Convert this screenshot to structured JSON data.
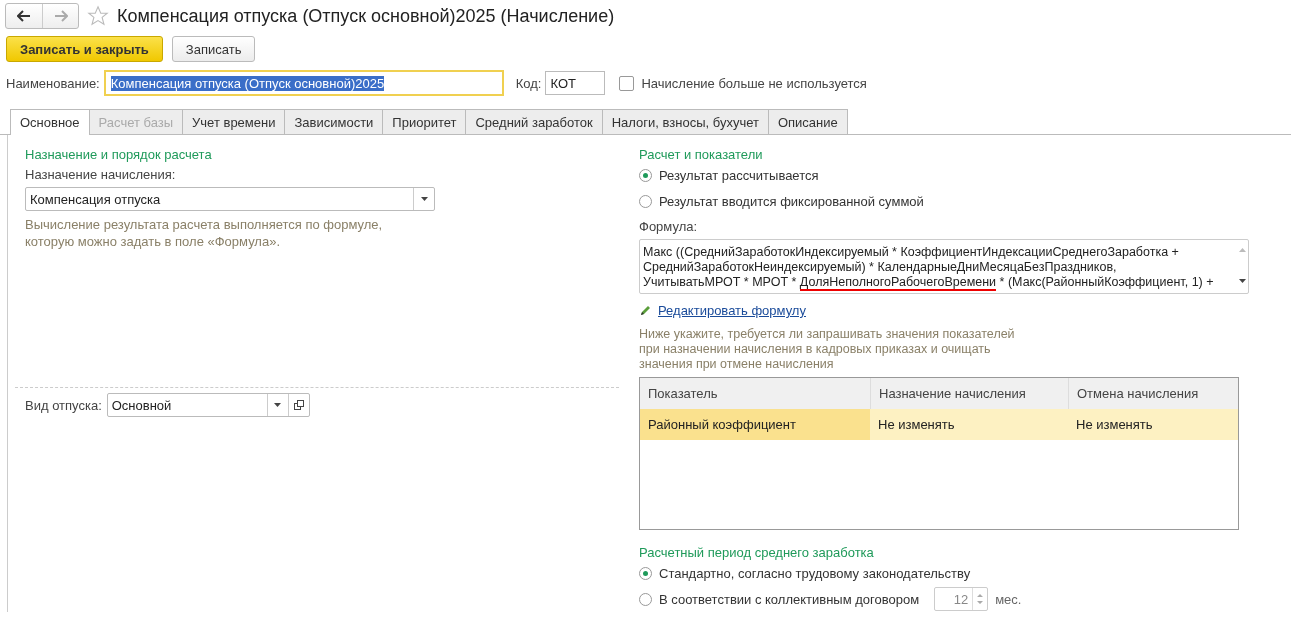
{
  "window": {
    "title": "Компенсация отпуска (Отпуск основной)2025 (Начисление)",
    "favorite": false
  },
  "toolbar": {
    "buttons": [
      {
        "label": "Записать и закрыть",
        "kind": "primary"
      },
      {
        "label": "Записать",
        "kind": "normal"
      }
    ]
  },
  "name_row": {
    "name_label": "Наименование:",
    "name_value": "Компенсация отпуска (Отпуск основной)2025",
    "code_label": "Код:",
    "code_value": "КОТ",
    "unused_label": "Начисление больше не используется",
    "unused_checked": false
  },
  "tabs": [
    {
      "label": "Основное",
      "selected": true,
      "disabled": false
    },
    {
      "label": "Расчет базы",
      "selected": false,
      "disabled": true
    },
    {
      "label": "Учет времени",
      "selected": false,
      "disabled": false
    },
    {
      "label": "Зависимости",
      "selected": false,
      "disabled": false
    },
    {
      "label": "Приоритет",
      "selected": false,
      "disabled": false
    },
    {
      "label": "Средний заработок",
      "selected": false,
      "disabled": false
    },
    {
      "label": "Налоги, взносы, бухучет",
      "selected": false,
      "disabled": false
    },
    {
      "label": "Описание",
      "selected": false,
      "disabled": false
    }
  ],
  "purpose": {
    "title": "Назначение и порядок расчета",
    "label": "Назначение начисления:",
    "value": "Компенсация отпуска",
    "hint_lines": [
      "Вычисление результата расчета выполняется по формуле,",
      "которую можно задать в поле «Формула»."
    ]
  },
  "leave_type": {
    "label": "Вид отпуска:",
    "value": "Основной"
  },
  "calculation": {
    "title": "Расчет и показатели",
    "options": [
      {
        "label": "Результат рассчитывается",
        "selected": true
      },
      {
        "label": "Результат вводится фиксированной суммой",
        "selected": false
      }
    ],
    "formula_label": "Формула:",
    "formula_lines": [
      [
        {
          "text": "Макс ((СреднийЗаработокИндексируемый * КоэффициентИндексацииСреднегоЗаработка +",
          "underlined": false
        }
      ],
      [
        {
          "text": "СреднийЗаработокНеиндексируемый) * КалендарныеДниМесяцаБезПраздников,",
          "underlined": false
        }
      ],
      [
        {
          "text": "УчитыватьМРОТ * МРОТ * ",
          "underlined": false
        },
        {
          "text": "ДоляНеполногоРабочегоВремени",
          "underlined": true
        },
        {
          "text": " * (Макс(РайонныйКоэффициент, 1) +",
          "underlined": false
        }
      ]
    ],
    "edit_link": "Редактировать формулу",
    "hint_lines": [
      "Ниже укажите, требуется ли запрашивать значения показателей",
      "при назначении начисления в кадровых приказах и очищать",
      "значения при отмене начисления"
    ]
  },
  "indicators_table": {
    "columns": [
      "Показатель",
      "Назначение начисления",
      "Отмена начисления"
    ],
    "rows": [
      {
        "cells": [
          "Районный коэффициент",
          "Не изменять",
          "Не изменять"
        ],
        "selected": true
      }
    ]
  },
  "average_period": {
    "title": "Расчетный период среднего заработка",
    "options": [
      {
        "label": "Стандартно, согласно трудовому законодательству",
        "selected": true
      },
      {
        "label": "В соответствии с коллективным договором",
        "selected": false
      }
    ],
    "months_value": "12",
    "months_unit": "мес."
  }
}
